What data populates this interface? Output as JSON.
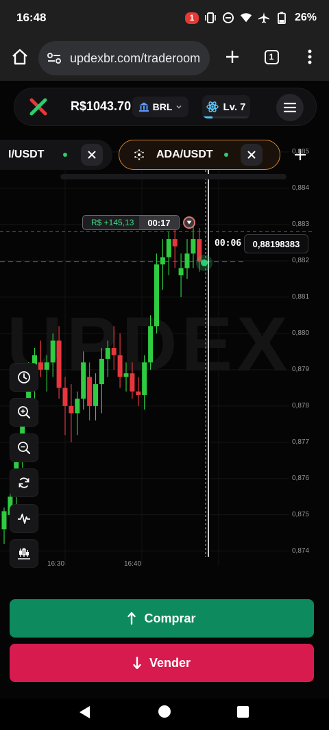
{
  "status_bar": {
    "time": "16:48",
    "notification_count": "1",
    "battery": "26%",
    "icons": [
      "vibrate-icon",
      "dnd-icon",
      "wifi-icon",
      "airplane-icon",
      "battery-icon"
    ]
  },
  "browser": {
    "url": "updexbr.com/traderoom",
    "tab_count": "1"
  },
  "header": {
    "balance": "R$1043.70",
    "currency": "BRL",
    "level": "Lv. 7",
    "level_progress": 0.22
  },
  "asset_tabs": [
    {
      "name": "I/USDT",
      "active": false
    },
    {
      "name": "ADA/USDT",
      "active": true
    }
  ],
  "watermark": "UPDEX",
  "trade": {
    "pnl": "R$ +145,13",
    "timer": "00:17",
    "countdown": "00:06",
    "current_price": "0,88198383"
  },
  "chart_data": {
    "type": "candlestick",
    "asset": "ADA/USDT",
    "y_ticks": [
      "0,885",
      "0,884",
      "0,883",
      "0,882",
      "0,881",
      "0,880",
      "0,879",
      "0,878",
      "0,877",
      "0,876",
      "0,875",
      "0,874"
    ],
    "y_tick_values": [
      0.885,
      0.884,
      0.883,
      0.882,
      0.881,
      0.88,
      0.879,
      0.878,
      0.877,
      0.876,
      0.875,
      0.874
    ],
    "ylim": [
      0.8736,
      0.8853
    ],
    "x_ticks": [
      "16:30",
      "16:40"
    ],
    "entry_price": 0.8828,
    "current_price": 0.88198383,
    "grid": true,
    "candles": [
      {
        "o": 0.8746,
        "h": 0.8752,
        "l": 0.8742,
        "c": 0.8751
      },
      {
        "o": 0.875,
        "h": 0.8756,
        "l": 0.8747,
        "c": 0.8755
      },
      {
        "o": 0.8755,
        "h": 0.8768,
        "l": 0.8752,
        "c": 0.8766
      },
      {
        "o": 0.8766,
        "h": 0.8782,
        "l": 0.8763,
        "c": 0.878
      },
      {
        "o": 0.878,
        "h": 0.8792,
        "l": 0.8778,
        "c": 0.879
      },
      {
        "o": 0.8786,
        "h": 0.8796,
        "l": 0.8782,
        "c": 0.8794
      },
      {
        "o": 0.8792,
        "h": 0.8798,
        "l": 0.8788,
        "c": 0.879
      },
      {
        "o": 0.879,
        "h": 0.8794,
        "l": 0.8784,
        "c": 0.8792
      },
      {
        "o": 0.8792,
        "h": 0.88,
        "l": 0.8788,
        "c": 0.8798
      },
      {
        "o": 0.8798,
        "h": 0.8802,
        "l": 0.8782,
        "c": 0.8785
      },
      {
        "o": 0.8785,
        "h": 0.8788,
        "l": 0.8772,
        "c": 0.878
      },
      {
        "o": 0.878,
        "h": 0.8786,
        "l": 0.877,
        "c": 0.8778
      },
      {
        "o": 0.8778,
        "h": 0.8784,
        "l": 0.8772,
        "c": 0.8782
      },
      {
        "o": 0.8782,
        "h": 0.8795,
        "l": 0.8779,
        "c": 0.8792
      },
      {
        "o": 0.8788,
        "h": 0.8792,
        "l": 0.8776,
        "c": 0.878
      },
      {
        "o": 0.878,
        "h": 0.8789,
        "l": 0.8776,
        "c": 0.8786
      },
      {
        "o": 0.8786,
        "h": 0.8796,
        "l": 0.8778,
        "c": 0.8793
      },
      {
        "o": 0.8793,
        "h": 0.8798,
        "l": 0.8788,
        "c": 0.8796
      },
      {
        "o": 0.8796,
        "h": 0.8802,
        "l": 0.879,
        "c": 0.8794
      },
      {
        "o": 0.8794,
        "h": 0.88,
        "l": 0.8785,
        "c": 0.8788
      },
      {
        "o": 0.8788,
        "h": 0.8792,
        "l": 0.8784,
        "c": 0.8789
      },
      {
        "o": 0.8789,
        "h": 0.8792,
        "l": 0.8782,
        "c": 0.8784
      },
      {
        "o": 0.8784,
        "h": 0.8788,
        "l": 0.878,
        "c": 0.8783
      },
      {
        "o": 0.8783,
        "h": 0.8794,
        "l": 0.8779,
        "c": 0.8792
      },
      {
        "o": 0.8792,
        "h": 0.8805,
        "l": 0.879,
        "c": 0.8802
      },
      {
        "o": 0.8802,
        "h": 0.8822,
        "l": 0.88,
        "c": 0.8819
      },
      {
        "o": 0.8819,
        "h": 0.8826,
        "l": 0.8812,
        "c": 0.8821
      },
      {
        "o": 0.8821,
        "h": 0.8828,
        "l": 0.8816,
        "c": 0.8826
      },
      {
        "o": 0.8826,
        "h": 0.8831,
        "l": 0.8818,
        "c": 0.8824
      },
      {
        "o": 0.8816,
        "h": 0.8822,
        "l": 0.881,
        "c": 0.8818
      },
      {
        "o": 0.8818,
        "h": 0.8826,
        "l": 0.8815,
        "c": 0.8822
      },
      {
        "o": 0.8822,
        "h": 0.8831,
        "l": 0.8818,
        "c": 0.8826
      },
      {
        "o": 0.8826,
        "h": 0.8829,
        "l": 0.8817,
        "c": 0.882
      }
    ]
  },
  "toolbar": [
    "clock-icon",
    "zoom-in-icon",
    "zoom-out-icon",
    "refresh-icon",
    "indicator-icon",
    "chart-type-icon"
  ],
  "actions": {
    "buy": "Comprar",
    "sell": "Vender"
  }
}
